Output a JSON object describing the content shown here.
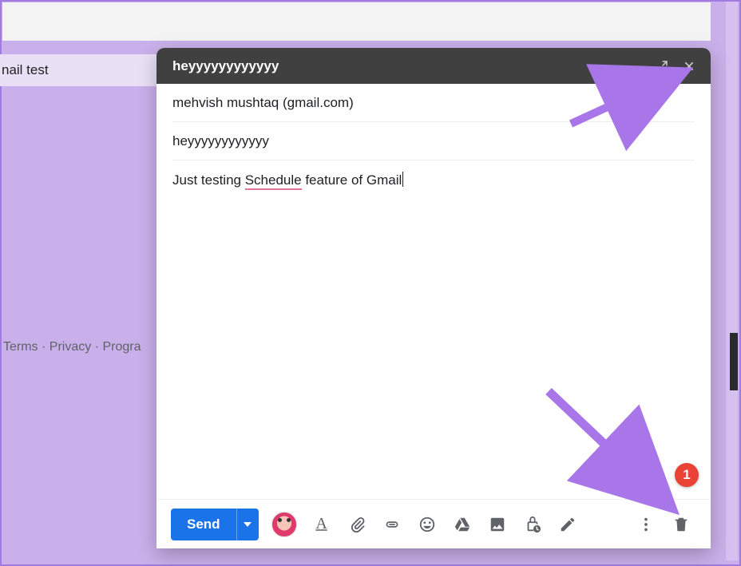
{
  "background": {
    "thread_subject": "nail test",
    "footer": {
      "terms": "Terms",
      "privacy": "Privacy",
      "program": "Progra",
      "sep": " · "
    }
  },
  "compose": {
    "title": "heyyyyyyyyyyyy",
    "to": "mehvish mushtaq (gmail.com)",
    "subject": "heyyyyyyyyyyyy",
    "body_pre": "Just testing ",
    "body_spell": "Schedule",
    "body_post": " feature of Gmail",
    "toolbar": {
      "send_label": "Send",
      "format_glyph": "A"
    }
  },
  "badge": {
    "count": "1"
  }
}
